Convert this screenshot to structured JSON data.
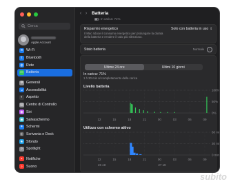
{
  "sidebar": {
    "search_placeholder": "Cerca",
    "account_subtitle": "Apple Account",
    "items": [
      {
        "label": "Wi-Fi",
        "icon": "wifi-icon",
        "color": "#1a7cf0",
        "glyph": "≋"
      },
      {
        "label": "Bluetooth",
        "icon": "bluetooth-icon",
        "color": "#1a7cf0",
        "glyph": "ᛒ"
      },
      {
        "label": "Rete",
        "icon": "network-icon",
        "color": "#1a7cf0",
        "glyph": "◍"
      },
      {
        "label": "Batteria",
        "icon": "battery-icon",
        "color": "#34c759",
        "glyph": "▭",
        "active": true
      },
      {
        "label": "Generali",
        "icon": "gear-icon",
        "color": "#8e8e93",
        "glyph": "⚙"
      },
      {
        "label": "Accessibilità",
        "icon": "accessibility-icon",
        "color": "#1a7cf0",
        "glyph": "☺"
      },
      {
        "label": "Aspetto",
        "icon": "appearance-icon",
        "color": "#3a3a3c",
        "glyph": "◐"
      },
      {
        "label": "Centro di Controllo",
        "icon": "control-center-icon",
        "color": "#8e8e93",
        "glyph": "▤"
      },
      {
        "label": "Siri",
        "icon": "siri-icon",
        "color": "#bf5af2",
        "glyph": "◉"
      },
      {
        "label": "Salvaschermo",
        "icon": "screensaver-icon",
        "color": "#30b0c7",
        "glyph": "▣"
      },
      {
        "label": "Schermi",
        "icon": "displays-icon",
        "color": "#1a7cf0",
        "glyph": "☀"
      },
      {
        "label": "Scrivania e Dock",
        "icon": "desktop-dock-icon",
        "color": "#3a3a3c",
        "glyph": "▥"
      },
      {
        "label": "Sfondo",
        "icon": "wallpaper-icon",
        "color": "#1a9ae0",
        "glyph": "❀"
      },
      {
        "label": "Spotlight",
        "icon": "spotlight-icon",
        "color": "#8e8e93",
        "glyph": "⌕"
      },
      {
        "label": "Notifiche",
        "icon": "notifications-icon",
        "color": "#ff3b30",
        "glyph": "▪"
      },
      {
        "label": "Suono",
        "icon": "sound-icon",
        "color": "#ff3b30",
        "glyph": "♪"
      }
    ]
  },
  "header": {
    "title": "Batteria",
    "subtitle": "In carica: 71%"
  },
  "energy_saving": {
    "title": "Risparmio energetico",
    "description": "Il Mac riduce il consumo energetico per prolungare la durata della batteria e rendere il calo più silenzioso.",
    "value": "Solo con batteria in uso"
  },
  "battery_state": {
    "label": "Stato batteria",
    "value": "Normale"
  },
  "tabs": [
    "Ultime 24 ore",
    "Ultimi 10 giorni"
  ],
  "charging": {
    "title": "In carica: 71%",
    "detail": "1 h 30 min al completamento della carica"
  },
  "battery_chart": {
    "title": "Livello batteria",
    "y_labels": [
      "100%",
      "50%",
      "0%"
    ],
    "x_labels": [
      "12",
      "15",
      "18",
      "21",
      "00",
      "03",
      "06",
      "09"
    ]
  },
  "screen_chart": {
    "title": "Utilizzo con schermo attivo",
    "y_labels": [
      "60 min",
      "30 min",
      "0 min"
    ],
    "x_labels": [
      "12",
      "15",
      "18",
      "21",
      "00",
      "03",
      "06",
      "09"
    ],
    "date_labels": [
      "26 ott",
      "27 ott"
    ]
  },
  "colors": {
    "accent": "#1a6ee0",
    "battery_bar": "#34c759",
    "screen_bar": "#2f86ff"
  },
  "chart_data": [
    {
      "type": "bar",
      "title": "Livello batteria",
      "ylabel": "",
      "ylim": [
        0,
        100
      ],
      "x": [
        18.2,
        18.4,
        18.6,
        19.2,
        20.0,
        20.8,
        21.6,
        23.0,
        24.2,
        25.6,
        27.0,
        33.4
      ],
      "values": [
        45,
        40,
        38,
        24,
        18,
        12,
        8,
        6,
        4,
        4,
        4,
        71
      ]
    },
    {
      "type": "bar",
      "title": "Utilizzo con schermo attivo",
      "ylabel": "",
      "ylim": [
        0,
        60
      ],
      "x": [
        18.3,
        18.6,
        19.0,
        19.5,
        20.2
      ],
      "values": [
        32,
        22,
        6,
        4,
        2
      ]
    }
  ]
}
